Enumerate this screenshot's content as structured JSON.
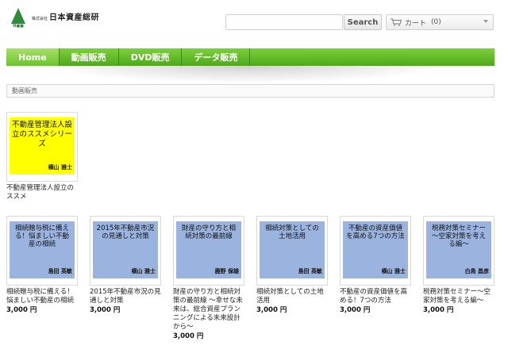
{
  "header": {
    "logo_mark_text": "N■■",
    "logo_small": "株式会社",
    "logo_name": "日本資産総研",
    "search_placeholder": "",
    "search_button": "Search",
    "cart_label": "カート",
    "cart_count": "(0)"
  },
  "nav": {
    "items": [
      {
        "label": "Home",
        "active": true
      },
      {
        "label": "動画販売",
        "active": false
      },
      {
        "label": "DVD販売",
        "active": false
      },
      {
        "label": "データ販売",
        "active": false
      }
    ]
  },
  "breadcrumb": "動画販売",
  "featured": {
    "cover_title": "不動産管理法人設立のススメシリーズ",
    "cover_author": "横山 雅士",
    "title": "不動産管理法人設立のススメ",
    "price": ""
  },
  "products": [
    {
      "cover_title": "相続贈与税に備える！悩ましい不動産の相続",
      "cover_author": "島田 英敏",
      "title": "相続贈与税に備える！悩ましい不動産の相続",
      "price": "3,000 円"
    },
    {
      "cover_title": "2015年不動産市況の見通しと対策",
      "cover_author": "横山 雅士",
      "title": "2015年不動産市況の見通しと対策",
      "price": "3,000 円"
    },
    {
      "cover_title": "財産の守り方と相続対策の最前線",
      "cover_author": "鹿野 保雄",
      "title": "財産の守り方と相続対策の最前線 〜幸せな未来は、総合資産プランニングによる未来設計から〜",
      "price": "3,000 円"
    },
    {
      "cover_title": "相続対策としての土地活用",
      "cover_author": "島田 英敏",
      "title": "相続対策としての土地活用",
      "price": "3,000 円"
    },
    {
      "cover_title": "不動産の資産価値を高める7つの方法",
      "cover_author": "横山 雅士",
      "title": "不動産の資産価値を高める！7つの方法",
      "price": "3,000 円"
    },
    {
      "cover_title": "税務対策セミナー 〜空家対策を考える編〜",
      "cover_author": "白鳥 昌彦",
      "title": "税務対策セミナー〜空家対策を考える編〜",
      "price": "3,000 円"
    }
  ]
}
